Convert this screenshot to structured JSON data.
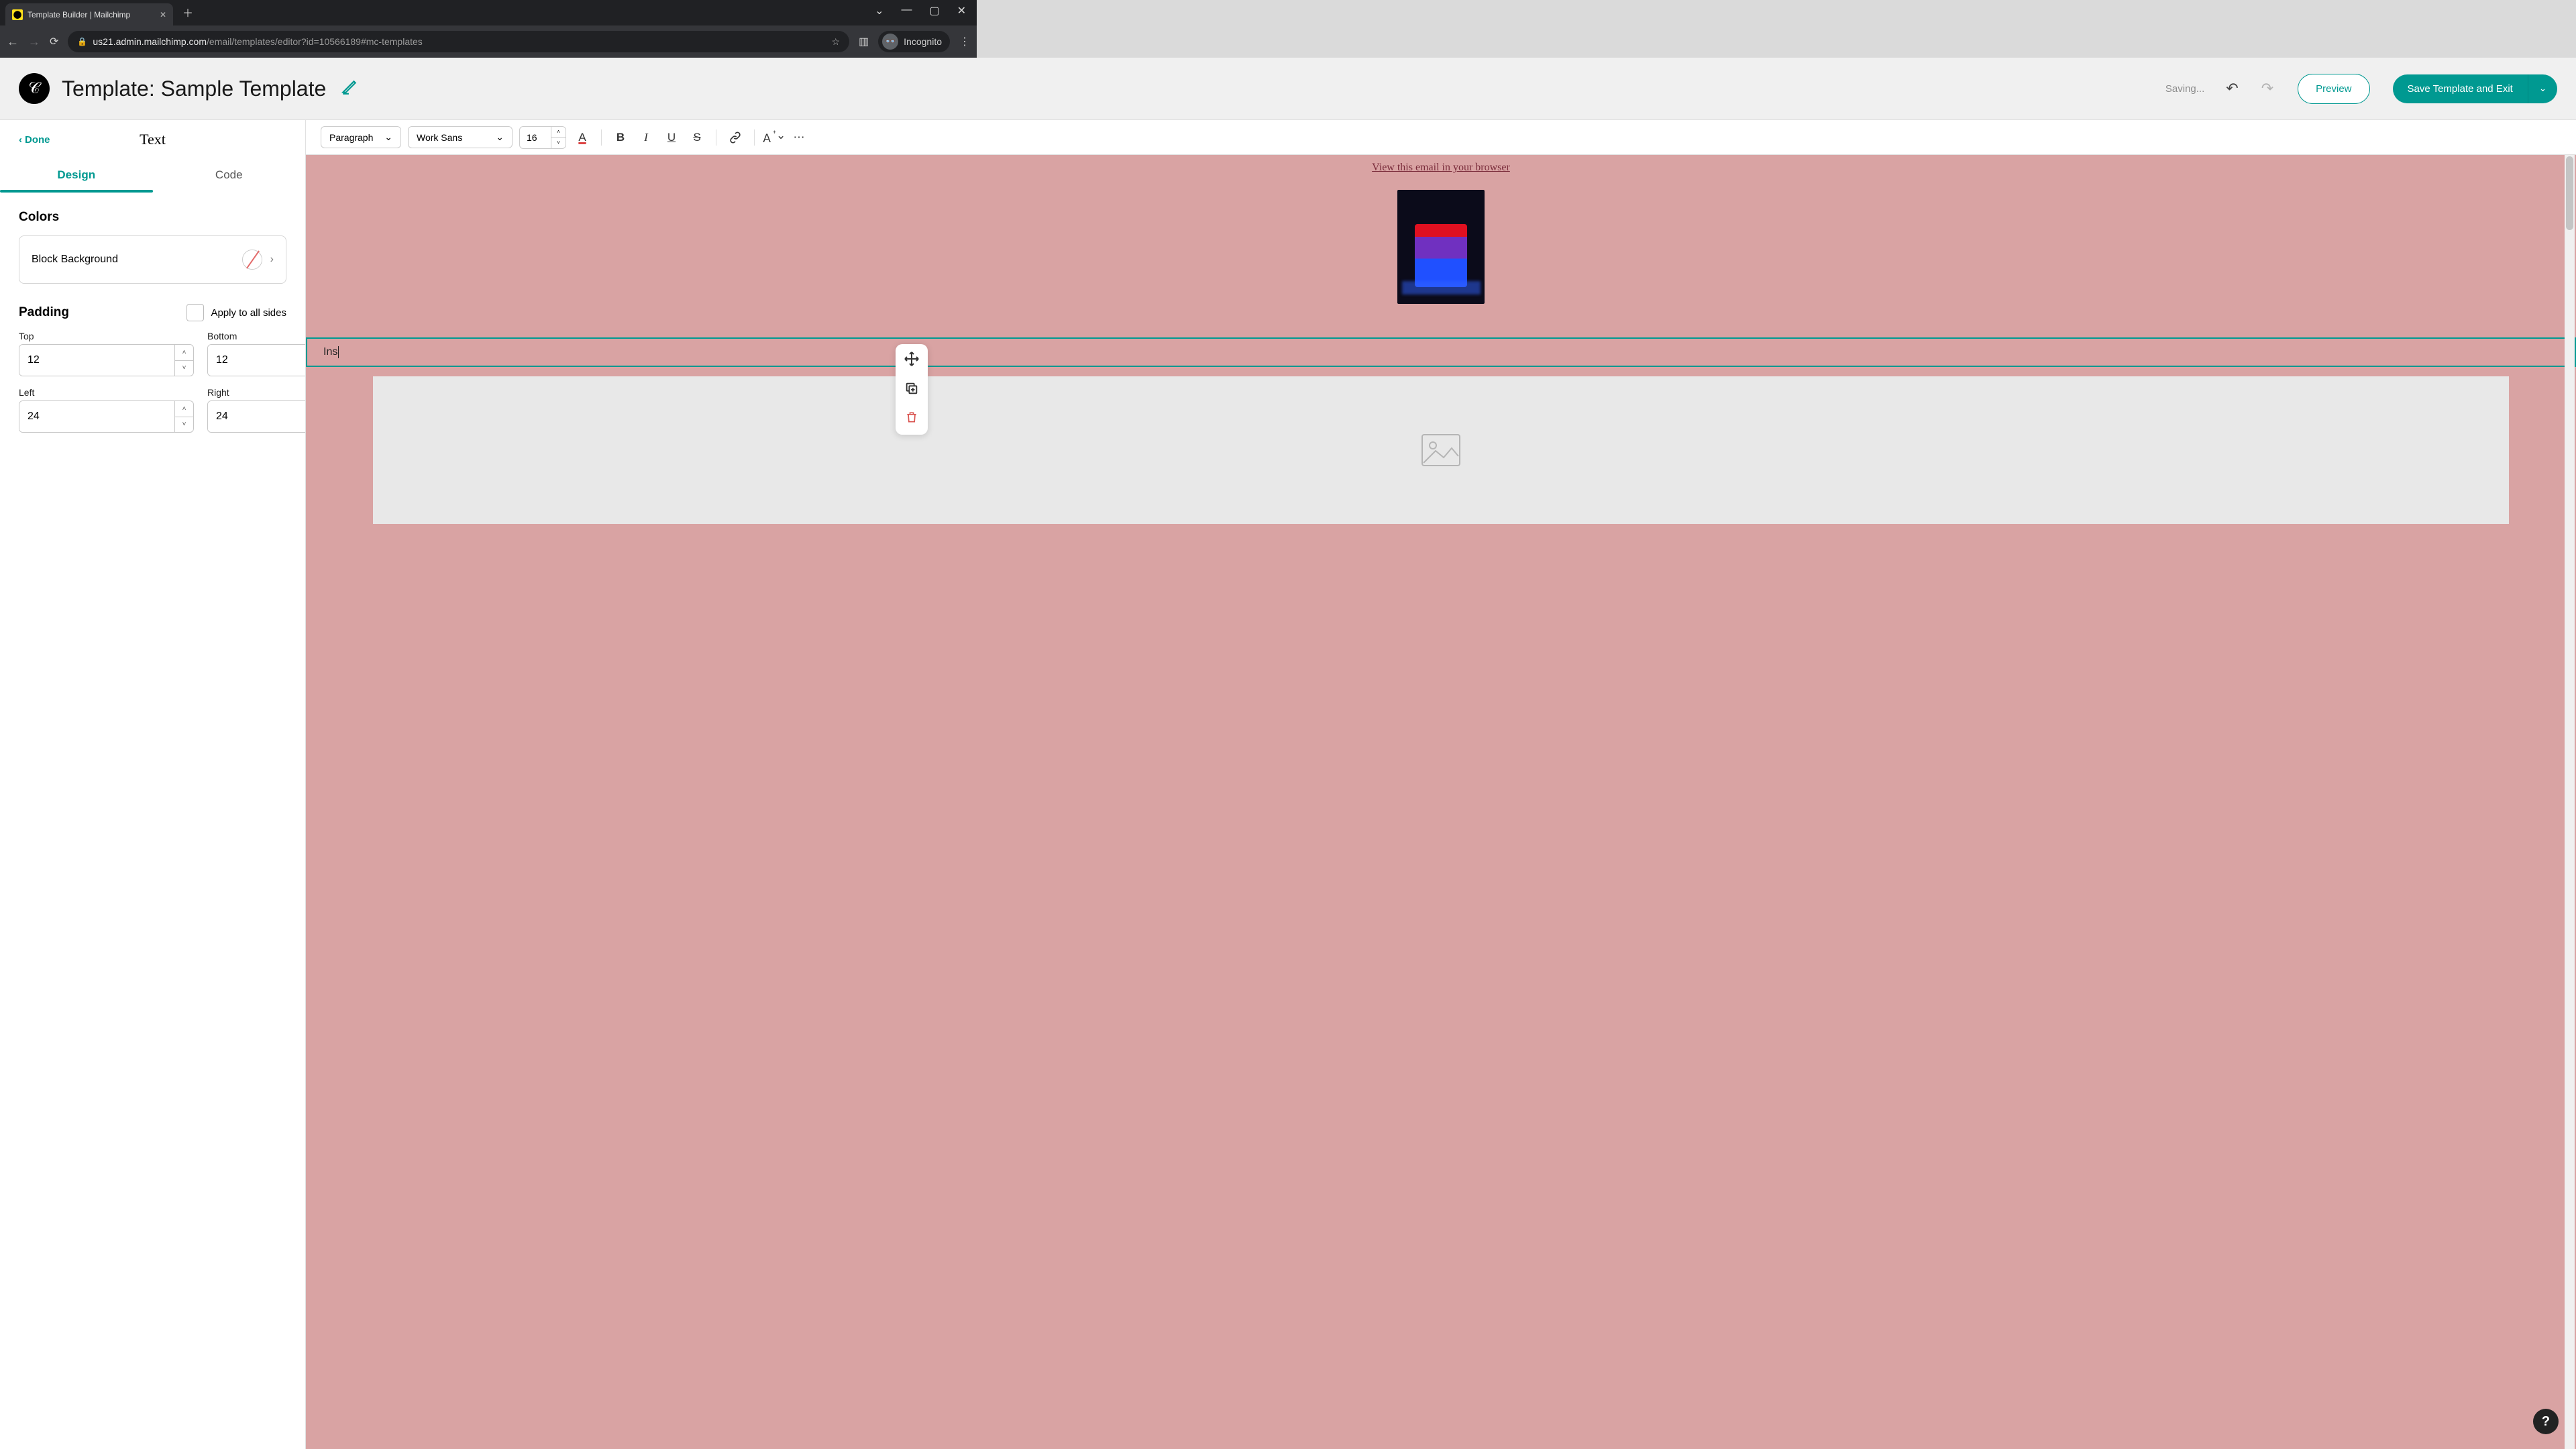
{
  "browser": {
    "tab_title": "Template Builder | Mailchimp",
    "url_host": "us21.admin.mailchimp.com",
    "url_path": "/email/templates/editor?id=10566189#mc-templates",
    "incognito_label": "Incognito"
  },
  "header": {
    "title_prefix": "Template: ",
    "title_name": "Sample Template",
    "saving": "Saving...",
    "preview": "Preview",
    "save": "Save Template and Exit"
  },
  "sidebar": {
    "done": "Done",
    "title": "Text",
    "tabs": {
      "design": "Design",
      "code": "Code"
    },
    "colors_heading": "Colors",
    "block_bg": "Block Background",
    "padding_heading": "Padding",
    "apply_all": "Apply to all sides",
    "fields": {
      "top": {
        "label": "Top",
        "value": "12"
      },
      "bottom": {
        "label": "Bottom",
        "value": "12"
      },
      "left": {
        "label": "Left",
        "value": "24"
      },
      "right": {
        "label": "Right",
        "value": "24"
      }
    }
  },
  "toolbar": {
    "block_format": "Paragraph",
    "font_family": "Work Sans",
    "font_size": "16"
  },
  "canvas": {
    "view_in_browser": "View this email in your browser",
    "text_block_content": "Ins"
  }
}
